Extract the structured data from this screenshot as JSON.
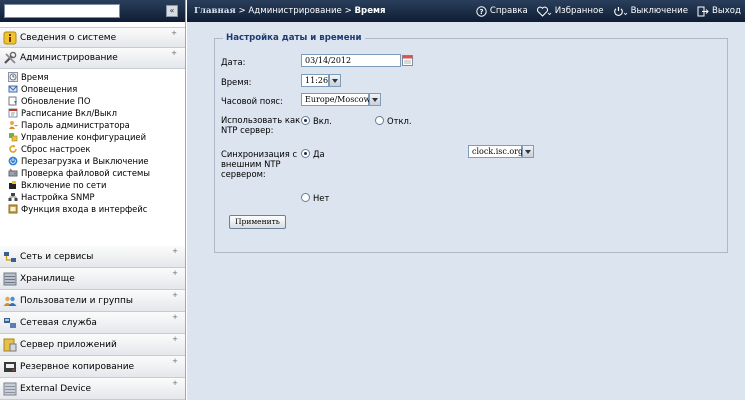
{
  "sidebar": {
    "search": {
      "value": "",
      "placeholder": ""
    },
    "collapse_label": "«",
    "top_sections": [
      {
        "label": "Сведения о системе",
        "icon": "info-icon"
      },
      {
        "label": "Администрирование",
        "icon": "tools-icon"
      }
    ],
    "admin_items": [
      {
        "label": "Время",
        "icon": "clock-icon"
      },
      {
        "label": "Оповещения",
        "icon": "notification-icon"
      },
      {
        "label": "Обновление ПО",
        "icon": "update-icon"
      },
      {
        "label": "Расписание Вкл/Выкл",
        "icon": "schedule-icon"
      },
      {
        "label": "Пароль администратора",
        "icon": "user-key-icon"
      },
      {
        "label": "Управление конфигурацией",
        "icon": "config-icon"
      },
      {
        "label": "Сброс настроек",
        "icon": "reset-icon"
      },
      {
        "label": "Перезагрузка и Выключение",
        "icon": "power-icon"
      },
      {
        "label": "Проверка файловой системы",
        "icon": "disk-check-icon"
      },
      {
        "label": "Включение по сети",
        "icon": "wol-icon"
      },
      {
        "label": "Настройка SNMP",
        "icon": "snmp-icon"
      },
      {
        "label": "Функция входа в интерфейс",
        "icon": "login-icon"
      }
    ],
    "bottom_sections": [
      {
        "label": "Сеть и сервисы",
        "icon": "network-icon"
      },
      {
        "label": "Хранилище",
        "icon": "storage-icon"
      },
      {
        "label": "Пользователи и группы",
        "icon": "users-icon"
      },
      {
        "label": "Сетевая служба",
        "icon": "network-service-icon"
      },
      {
        "label": "Сервер приложений",
        "icon": "app-server-icon"
      },
      {
        "label": "Резервное копирование",
        "icon": "backup-icon"
      },
      {
        "label": "External Device",
        "icon": "external-device-icon"
      }
    ]
  },
  "topbar": {
    "breadcrumb_home": "Главная",
    "breadcrumb_sep": ">",
    "breadcrumb_admin": "Администрирование",
    "breadcrumb_current": "Время",
    "links": {
      "help": "Справка",
      "favorites": "Избранное",
      "shutdown": "Выключение",
      "logout": "Выход"
    }
  },
  "form": {
    "legend": "Настройка даты и времени",
    "date_label": "Дата:",
    "date_value": "03/14/2012",
    "time_label": "Время:",
    "time_value": "11:26",
    "tz_label": "Часовой пояс:",
    "tz_value": "Europe/Moscow",
    "ntp_server_label_1": "Использовать как",
    "ntp_server_label_2": "NTP сервер:",
    "ntp_on": "Вкл.",
    "ntp_off": "Откл.",
    "sync_label_1": "Синхронизация с",
    "sync_label_2": "внешним NTP",
    "sync_label_3": "сервером:",
    "sync_yes": "Да",
    "sync_no": "Нет",
    "ntp_host": "clock.isc.org",
    "apply": "Применить"
  },
  "colors": {
    "topbar": "#1b2c48",
    "content_bg": "#dce4ef",
    "legend_text": "#1e3a6e"
  }
}
